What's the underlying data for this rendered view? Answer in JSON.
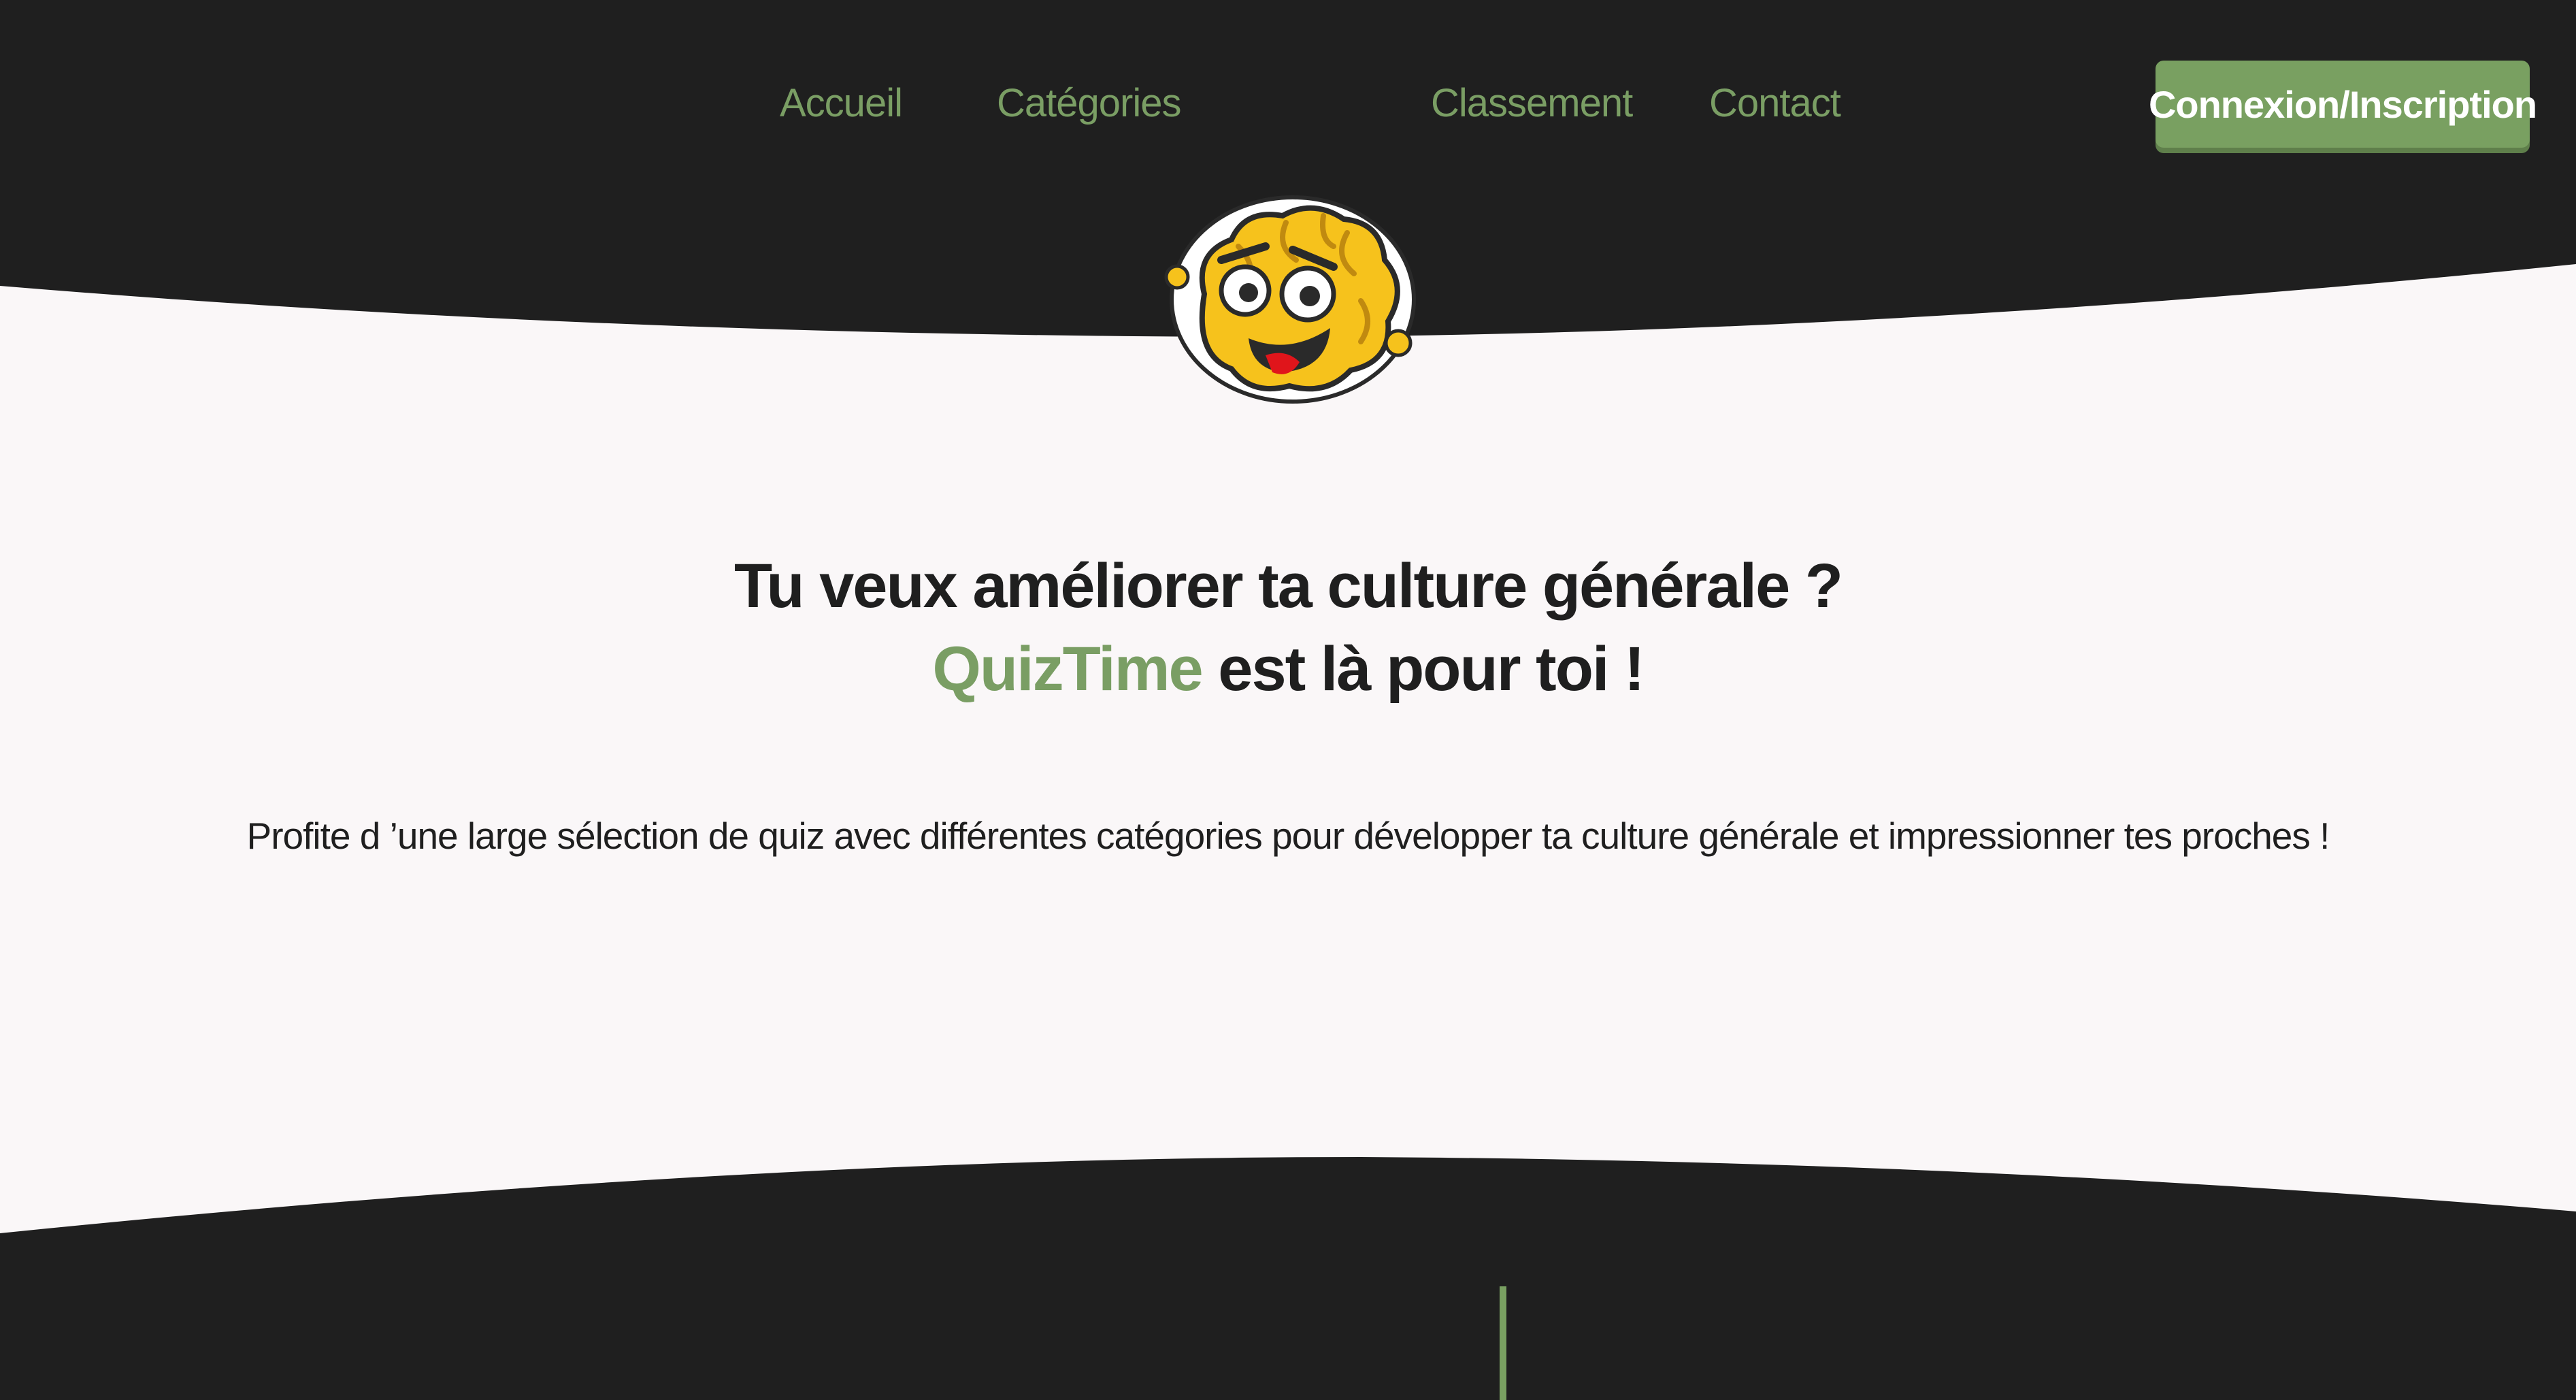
{
  "nav": {
    "items": [
      {
        "label": "Accueil"
      },
      {
        "label": "Catégories"
      },
      {
        "label": "Classement"
      },
      {
        "label": "Contact"
      }
    ],
    "login_label": "Connexion/Inscription"
  },
  "hero": {
    "title_line1": "Tu veux améliorer ta culture générale ?",
    "brand": "QuizTime",
    "title_line2_rest": " est là pour toi !",
    "subtitle": "Profite d ’une large sélection de quiz avec différentes catégories pour développer ta culture générale et impressionner tes proches !"
  },
  "colors": {
    "dark": "#1f1f1f",
    "accent": "#79a061",
    "background": "#faf7f8"
  },
  "icons": {
    "mascot": "brain-mascot-icon"
  }
}
